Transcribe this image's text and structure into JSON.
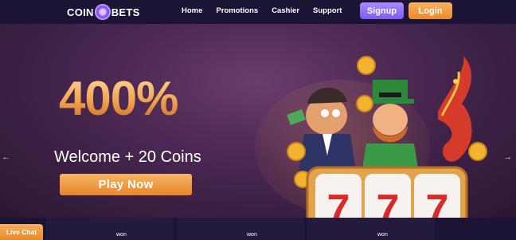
{
  "header": {
    "logo_left": "COIN",
    "logo_right": "BETS",
    "nav": [
      "Home",
      "Promotions",
      "Cashier",
      "Support"
    ],
    "signup_label": "Signup",
    "login_label": "Login"
  },
  "hero": {
    "headline": "400%",
    "subhead": "Welcome + 20 Coins",
    "cta_label": "Play Now",
    "slot_symbols": [
      "7",
      "7",
      "7"
    ]
  },
  "footer": {
    "live_chat_label": "Live Chat",
    "wins": [
      "won",
      "won",
      "won"
    ]
  },
  "colors": {
    "accent_orange": "#ea8a2a",
    "accent_purple": "#7c5cf0",
    "header_bg": "#1c1434"
  }
}
